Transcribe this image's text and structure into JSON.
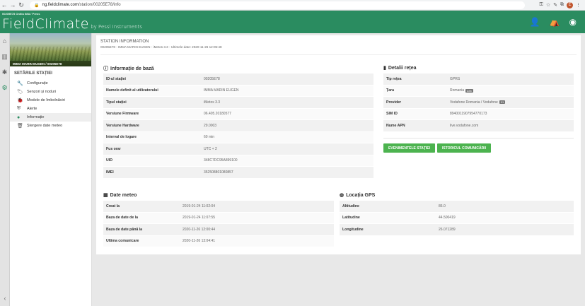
{
  "browser": {
    "url_host": "ng.fieldclimate.com",
    "url_path": "/station/00205E78/info"
  },
  "header": {
    "station_tag": "00205E78 Onitiu IMA / Press",
    "logo_main": "FieldClimate",
    "logo_sub": " by Pessl Instruments"
  },
  "sidebar": {
    "field_caption": "IMMA MARIN EUGEN / 00205E78",
    "menu_title": "SETĂRILE STAȚIEI",
    "items": [
      {
        "label": "Configurație",
        "icon": "wrench-icon",
        "active": false
      },
      {
        "label": "Senzori și noduri",
        "icon": "tag-icon",
        "active": false
      },
      {
        "label": "Modele de îmbolnăviri",
        "icon": "bug-icon",
        "active": false
      },
      {
        "label": "Alerte",
        "icon": "shield-icon",
        "active": false
      },
      {
        "label": "Informație",
        "icon": "info-icon",
        "active": true
      },
      {
        "label": "Ștergere date meteo",
        "icon": "trash-icon",
        "active": false
      }
    ]
  },
  "main": {
    "title": "STATION INFORMATION",
    "subtitle": "00205E78 - IMMA MARIN EUGEN - iMetos 3.3 - Ultimele date: 2020-11-26 12:05:48",
    "basic": {
      "title": "Informație de bază",
      "rows": [
        {
          "key": "ID-ul stației",
          "value": "00205E78"
        },
        {
          "key": "Numele definit al utilizatorului",
          "value": "IMMA MARIN EUGEN"
        },
        {
          "key": "Tipul stației",
          "value": "iMetos 3.3"
        },
        {
          "key": "Versiune Firmware",
          "value": "06.405.20180577"
        },
        {
          "key": "Versiune Hardware",
          "value": "29.0003"
        },
        {
          "key": "Interval de logare",
          "value": "60 min"
        },
        {
          "key": "Fus orar",
          "value": "UTC + 2"
        },
        {
          "key": "UID",
          "value": "348C7DC95A899100"
        },
        {
          "key": "IMEI",
          "value": "352508801080857"
        }
      ]
    },
    "network": {
      "title": "Detalii rețea",
      "rows": [
        {
          "key": "Tip rețea",
          "value": "GPRS",
          "chip": ""
        },
        {
          "key": "Țara",
          "value": "Romania",
          "chip": "226"
        },
        {
          "key": "Provider",
          "value": "Vodafone Romania / Vodafone",
          "chip": "01"
        },
        {
          "key": "SIM ID",
          "value": "8940011907954770173",
          "chip": ""
        },
        {
          "key": "Nume APN",
          "value": "live.vodafone.com",
          "chip": ""
        }
      ],
      "btn_events": "EVENIMENTELE STAȚIEI",
      "btn_comm": "ISTORICUL COMUNICĂRII"
    },
    "weather": {
      "title": "Date meteo",
      "rows": [
        {
          "key": "Creat la",
          "value": "2019-01-24 11:02:04"
        },
        {
          "key": "Baza de date de la",
          "value": "2019-01-24 11:07:55"
        },
        {
          "key": "Baza de date până la",
          "value": "2020-11-26 12:00:44"
        },
        {
          "key": "Ultima comunicare",
          "value": "2020-11-26 13:04:41"
        }
      ]
    },
    "gps": {
      "title": "Locația GPS",
      "rows": [
        {
          "key": "Altitudine",
          "value": "86.0"
        },
        {
          "key": "Latitudine",
          "value": "44.500419"
        },
        {
          "key": "Longitudine",
          "value": "26.071289"
        }
      ]
    }
  },
  "colors": {
    "brand": "#2a8c60",
    "button": "#4cb34f"
  }
}
